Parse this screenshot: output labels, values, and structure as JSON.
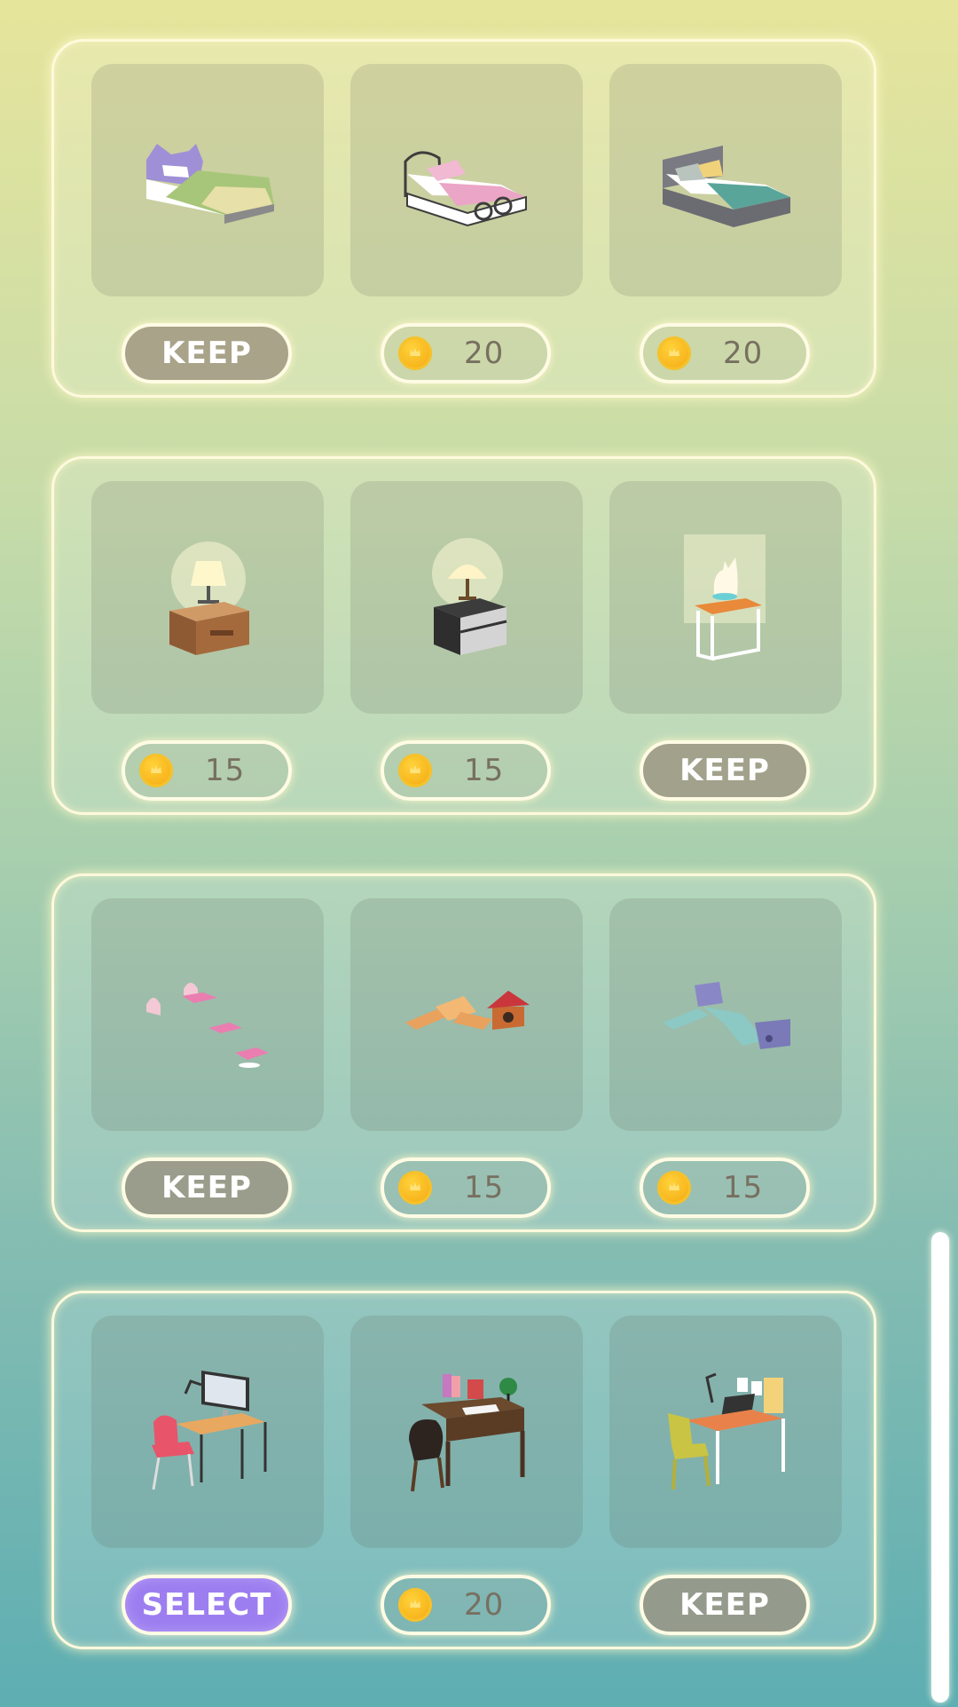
{
  "sections": [
    {
      "category": "beds",
      "items": [
        {
          "name": "cat-ear-bed",
          "icon": "cat-ear-bed-icon",
          "button": {
            "type": "keep",
            "label": "KEEP"
          }
        },
        {
          "name": "iron-frame-bed",
          "icon": "iron-frame-bed-icon",
          "button": {
            "type": "price",
            "label": "20"
          }
        },
        {
          "name": "gray-bed",
          "icon": "gray-bed-icon",
          "button": {
            "type": "price",
            "label": "20"
          }
        }
      ]
    },
    {
      "category": "nightstands",
      "items": [
        {
          "name": "wood-nightstand-lamp",
          "icon": "wood-nightstand-lamp-icon",
          "button": {
            "type": "price",
            "label": "15"
          }
        },
        {
          "name": "black-nightstand-lamp",
          "icon": "black-nightstand-lamp-icon",
          "button": {
            "type": "price",
            "label": "15"
          }
        },
        {
          "name": "cat-lamp-table",
          "icon": "cat-lamp-table-icon",
          "button": {
            "type": "keep",
            "label": "KEEP"
          }
        }
      ]
    },
    {
      "category": "cat-play",
      "items": [
        {
          "name": "pink-steps",
          "icon": "pink-steps-icon",
          "button": {
            "type": "keep",
            "label": "KEEP"
          }
        },
        {
          "name": "bridge-cat-house",
          "icon": "bridge-cat-house-icon",
          "button": {
            "type": "price",
            "label": "15"
          }
        },
        {
          "name": "blue-slide",
          "icon": "blue-slide-icon",
          "button": {
            "type": "price",
            "label": "15"
          }
        }
      ]
    },
    {
      "category": "desks",
      "items": [
        {
          "name": "computer-desk",
          "icon": "computer-desk-icon",
          "button": {
            "type": "select",
            "label": "SELECT"
          }
        },
        {
          "name": "vintage-desk",
          "icon": "vintage-desk-icon",
          "button": {
            "type": "price",
            "label": "20"
          }
        },
        {
          "name": "laptop-desk",
          "icon": "laptop-desk-icon",
          "button": {
            "type": "keep",
            "label": "KEEP"
          }
        }
      ]
    }
  ],
  "colors": {
    "select": "#9d7ef0",
    "keep": "#9b917d",
    "coin": "#f7b21a",
    "glow": "#fff9dc"
  }
}
